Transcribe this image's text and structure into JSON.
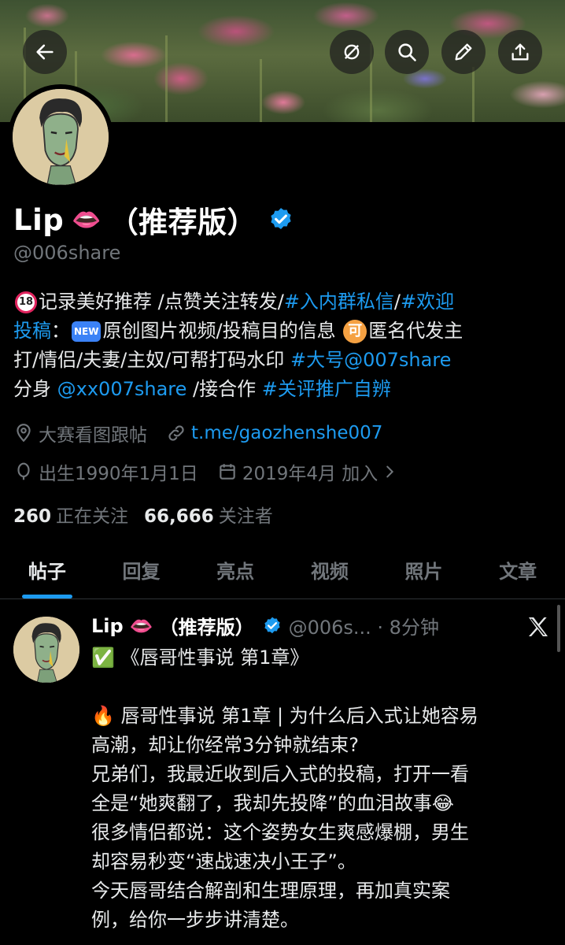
{
  "header": {
    "back_icon": "arrow-left-icon",
    "actions": [
      "mute-icon",
      "search-icon",
      "edit-icon",
      "share-icon"
    ]
  },
  "profile": {
    "name": "Lip",
    "name_emoji": "👄",
    "name_suffix": "（推荐版）",
    "verified_color": "#1d9bf0",
    "handle": "@006share",
    "bio": {
      "l1_a": "记录美好推荐 /点赞关注转发/",
      "l1_tag1": "#入内群私信",
      "l1_slash": "/",
      "l1_tag2": "#欢迎",
      "l2_tag": "投稿",
      "l2_a": "：",
      "l2_new": "NEW",
      "l2_b": "原创图片视频/投稿目的信息",
      "l2_ke": "可",
      "l2_c": "匿名代发主",
      "l3_a": "打/情侣/夫妻/主奴/可帮打码水印 ",
      "l3_tag": "#大号@007share",
      "l4_a": "分身 ",
      "l4_link": "@xx007share",
      "l4_b": " /接合作 ",
      "l4_tag": "#关评推广自辨",
      "badge18": "18"
    },
    "location": "大赛看图跟帖",
    "link": "t.me/gaozhenshe007",
    "birthday": "出生1990年1月1日",
    "joined": "2019年4月 加入",
    "following_count": "260",
    "following_label": "正在关注",
    "followers_count": "66,666",
    "followers_label": "关注者"
  },
  "tabs": [
    {
      "label": "帖子",
      "active": true
    },
    {
      "label": "回复"
    },
    {
      "label": "亮点"
    },
    {
      "label": "视频"
    },
    {
      "label": "照片"
    },
    {
      "label": "文章"
    }
  ],
  "tweet": {
    "name": "Lip",
    "name_emoji": "👄",
    "name_suffix": "（推荐版）",
    "handle_time": "@006s... · 8分钟",
    "line1": "✅ 《唇哥性事说 第1章》",
    "line2": "🔥 唇哥性事说 第1章 | 为什么后入式让她容易",
    "line3": "高潮，却让你经常3分钟就结束?",
    "line4": "兄弟们，我最近收到后入式的投稿，打开一看",
    "line5": "全是“她爽翻了，我却先投降”的血泪故事😂",
    "line6": "很多情侣都说：这个姿势女生爽感爆棚，男生",
    "line7": "却容易秒变“速战速决小王子”。",
    "line8": "今天唇哥结合解剖和生理原理，再加真实案",
    "line9": "例，给你一步步讲清楚。"
  }
}
